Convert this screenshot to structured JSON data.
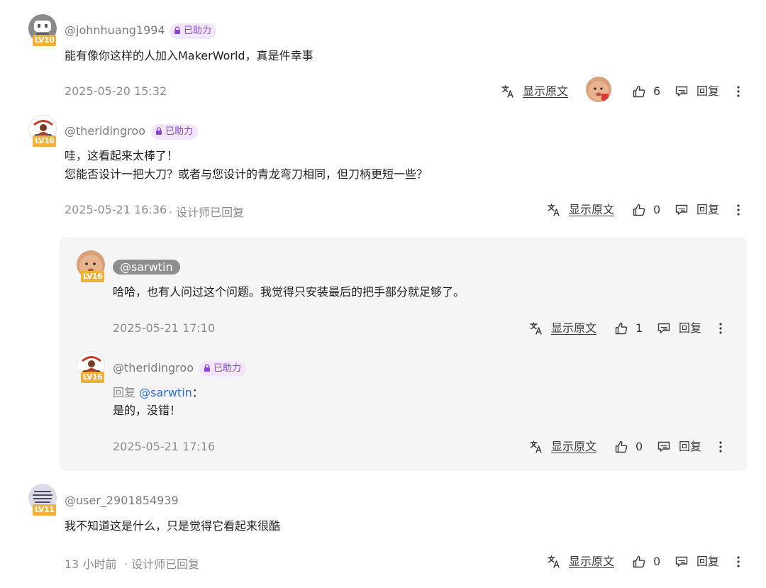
{
  "comments": [
    {
      "username": "@johnhuang1994",
      "level": "LV10",
      "badge": "已助力",
      "lines": [
        "能有像你这样的人加入MakerWorld，真是件幸事"
      ],
      "timestamp": "2025-05-20 15:32",
      "translate_label": "显示原文",
      "likes": "6",
      "reply_label": "回复"
    },
    {
      "username": "@theridingroo",
      "level": "LV16",
      "badge": "已助力",
      "lines": [
        "哇，这看起来太棒了！",
        "您能否设计一把大刀？或者与您设计的青龙弯刀相同，但刀柄更短一些？"
      ],
      "timestamp": "2025-05-21 16:36",
      "designer_replied": "· 设计师已回复",
      "translate_label": "显示原文",
      "likes": "0",
      "reply_label": "回复"
    },
    {
      "username": "@user_2901854939",
      "level": "LV11",
      "lines": [
        "我不知道这是什么，只是觉得它看起来很酷"
      ],
      "timestamp": "13 小时前",
      "designer_replied": "· 设计师已回复",
      "translate_label": "显示原文",
      "likes": "0",
      "reply_label": "回复"
    }
  ],
  "replies": [
    {
      "username": "@sarwtin",
      "level": "LV16",
      "lines": [
        "哈哈，也有人问过这个问题。我觉得只安装最后的把手部分就足够了。"
      ],
      "timestamp": "2025-05-21 17:10",
      "translate_label": "显示原文",
      "likes": "1",
      "reply_label": "回复"
    },
    {
      "username": "@theridingroo",
      "level": "LV16",
      "badge": "已助力",
      "reply_prefix": "回复",
      "reply_target": "@sarwtin",
      "reply_colon": "：",
      "lines": [
        "是的，没错！"
      ],
      "timestamp": "2025-05-21 17:16",
      "translate_label": "显示原文",
      "likes": "0",
      "reply_label": "回复"
    }
  ],
  "colors": {
    "badge_bg": "#f1e6fb",
    "badge_text": "#8a45d6",
    "level_bg": "#f0b13a",
    "mention": "#2a6fd1",
    "reply_panel_bg": "#f5f5f5"
  }
}
